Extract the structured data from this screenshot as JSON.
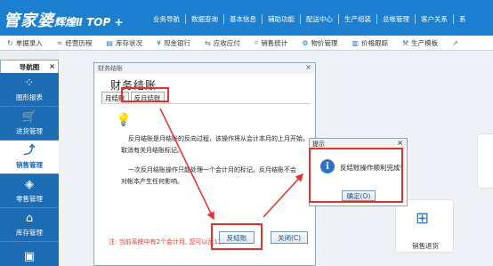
{
  "app": {
    "logo_main": "管家婆",
    "logo_sub": "辉煌Ⅱ TOP +"
  },
  "top_menu": [
    "业务导航",
    "数据查询",
    "基本信息",
    "辅助功能",
    "配送中心",
    "生产组装",
    "总帐管理",
    "客户关系",
    "系"
  ],
  "toolbar": [
    {
      "icon": "cart-icon",
      "glyph": "↻",
      "label": "单据录入"
    },
    {
      "icon": "history-icon",
      "glyph": "≈",
      "label": "经营历程"
    },
    {
      "icon": "stock-icon",
      "glyph": "▤",
      "label": "库存状况"
    },
    {
      "icon": "bank-icon",
      "glyph": "¥",
      "label": "现金银行"
    },
    {
      "icon": "arap-icon",
      "glyph": "⇆",
      "label": "应收应付"
    },
    {
      "icon": "sales-stats-icon",
      "glyph": "⌕",
      "label": "销售统计"
    },
    {
      "icon": "goods-icon",
      "glyph": "⚙",
      "label": "物价管理"
    },
    {
      "icon": "price-track-icon",
      "glyph": "▥",
      "label": "价格跟踪"
    },
    {
      "icon": "production-icon",
      "glyph": "⚒",
      "label": "生产模板"
    },
    {
      "icon": "more-icon",
      "glyph": "↗",
      "label": ""
    }
  ],
  "nav": {
    "tab_label": "导航图",
    "close": "×",
    "items": [
      {
        "icon": "report-icon",
        "glyph": "⁘",
        "label": "图形报表",
        "active": false
      },
      {
        "icon": "purchase-cart-icon",
        "glyph": "🛒",
        "label": "进货管理",
        "active": false
      },
      {
        "icon": "sales-chart-icon",
        "glyph": "⤴",
        "label": "销售管理",
        "active": true
      },
      {
        "icon": "retail-tag-icon",
        "glyph": "◈",
        "label": "零售管理",
        "active": false
      },
      {
        "icon": "warehouse-icon",
        "glyph": "⌂",
        "label": "库存管理",
        "active": false
      },
      {
        "icon": "money-icon",
        "glyph": "▣",
        "label": "",
        "active": false
      }
    ]
  },
  "dialog": {
    "window_title": "财务结账",
    "close": "×",
    "title": "财务结账",
    "tabs": [
      "月结账",
      "反月结账"
    ],
    "active_tab": "反月结账",
    "paragraph1_line1": "反月结账是月结账的反向过程，该操作将从会计本月的上月开始，",
    "paragraph1_line2": "取消有关月结账标记。",
    "paragraph2_line1": "一次反月结账操作只能处理一个会计月的标记。反月结账不会",
    "paragraph2_line2": "对帐本产生任何影响。",
    "note": "注: 当前系统中有2个会计月, 您可以反1次",
    "btn_unclose": "反结账",
    "btn_close": "关闭(C)"
  },
  "popup": {
    "title": "提示",
    "close": "×",
    "icon_glyph": "i",
    "message": "反结账操作顺利完成!",
    "ok": "确定(O)"
  },
  "card": {
    "icon_glyph": "⊞",
    "label": "销售退货"
  },
  "colors": {
    "brand": "#1c7fcf",
    "nav": "#1e6cb3",
    "highlight": "#e0332b"
  }
}
